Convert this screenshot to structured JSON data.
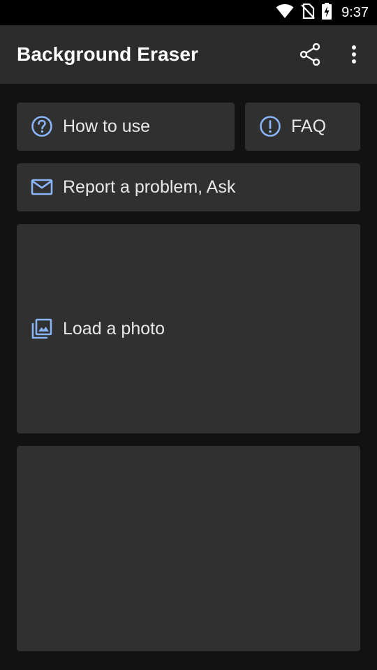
{
  "status_bar": {
    "time": "9:37",
    "icons": [
      "wifi-icon",
      "no-sim-icon",
      "battery-charging-icon"
    ]
  },
  "app_bar": {
    "title": "Background Eraser",
    "actions": [
      "share-icon",
      "more-vert-icon"
    ]
  },
  "buttons": {
    "how_to_use": {
      "label": "How to use",
      "icon": "help-circle-icon"
    },
    "faq": {
      "label": "FAQ",
      "icon": "alert-circle-icon"
    },
    "report": {
      "label": "Report a problem, Ask",
      "icon": "mail-icon"
    },
    "load_photo": {
      "label": "Load a photo",
      "icon": "photo-library-icon"
    }
  },
  "colors": {
    "accent": "#8ab4f8",
    "card_bg": "#303030",
    "app_bar_bg": "#2c2c2c",
    "page_bg": "#121212"
  }
}
